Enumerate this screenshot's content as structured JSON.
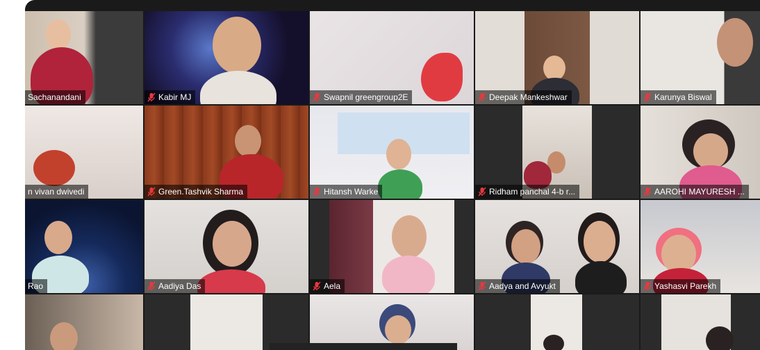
{
  "tiles": [
    {
      "name": "Sachanandani",
      "muted": false,
      "active": true
    },
    {
      "name": "Kabir MJ",
      "muted": true
    },
    {
      "name": "Swapnil greengroup2E",
      "muted": true
    },
    {
      "name": "Deepak Mankeshwar",
      "muted": true
    },
    {
      "name": "Karunya Biswal",
      "muted": true
    },
    {
      "name": "n vivan dwivedi",
      "muted": false
    },
    {
      "name": "Green.Tashvik Sharma",
      "muted": true
    },
    {
      "name": "Hitansh Warke",
      "muted": true
    },
    {
      "name": "Ridham panchal 4-b r...",
      "muted": true
    },
    {
      "name": "AAROHI MAYURESH ...",
      "muted": true
    },
    {
      "name": "Rao",
      "muted": false
    },
    {
      "name": "Aadiya Das",
      "muted": true
    },
    {
      "name": "Aela",
      "muted": true
    },
    {
      "name": "Aadya and Avyukt",
      "muted": true
    },
    {
      "name": "Yashasvi Parekh",
      "muted": true
    }
  ],
  "colors": {
    "muted_icon": "#e8383d",
    "active_border": "#d7e46a",
    "background": "#1a1a1a"
  }
}
